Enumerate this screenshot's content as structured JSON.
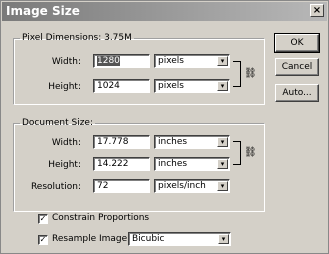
{
  "window": {
    "title": "Image Size",
    "close_glyph": "×"
  },
  "pixel_dimensions": {
    "legend": "Pixel Dimensions:  3.75M",
    "width": {
      "label": "Width:",
      "value": "1280",
      "unit": "pixels"
    },
    "height": {
      "label": "Height:",
      "value": "1024",
      "unit": "pixels"
    },
    "link_icon": "link-icon"
  },
  "document_size": {
    "legend": "Document Size:",
    "width": {
      "label": "Width:",
      "value": "17.778",
      "unit": "inches"
    },
    "height": {
      "label": "Height:",
      "value": "14.222",
      "unit": "inches"
    },
    "resolution": {
      "label": "Resolution:",
      "value": "72",
      "unit": "pixels/inch"
    },
    "link_icon": "link-icon"
  },
  "options": {
    "constrain": {
      "label": "Constrain Proportions",
      "checked": true
    },
    "resample": {
      "label": "Resample Image:",
      "checked": true,
      "method": "Bicubic"
    }
  },
  "buttons": {
    "ok": "OK",
    "cancel": "Cancel",
    "auto": "Auto..."
  },
  "glyphs": {
    "check": "✓",
    "dropdown": "▾",
    "chain": "⛓"
  }
}
